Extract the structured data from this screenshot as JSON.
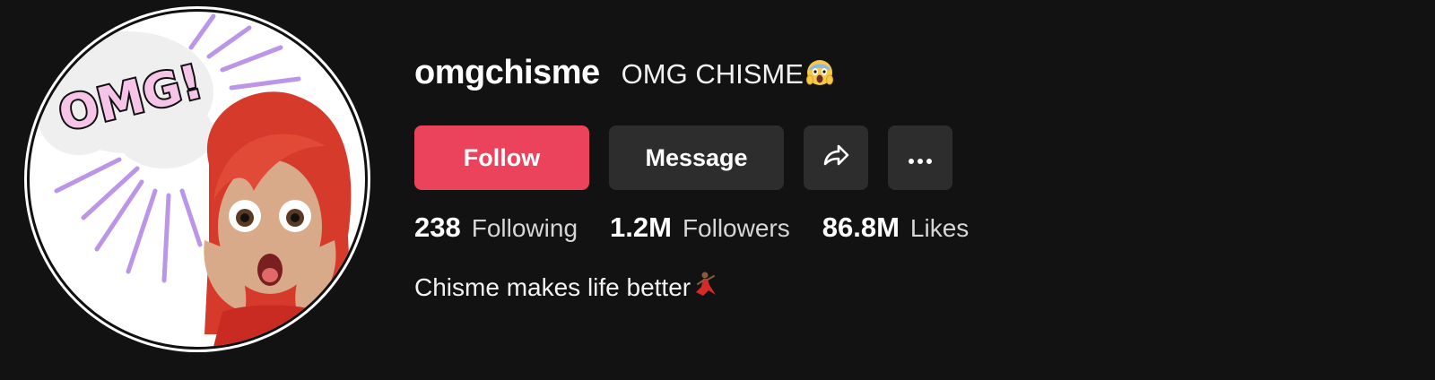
{
  "profile": {
    "username": "omgchisme",
    "nickname": "OMG CHISME",
    "nickname_emoji": "scream-emoji",
    "bio": "Chisme makes life better",
    "bio_emoji": "dancer-emoji",
    "avatar_text": "OMG!"
  },
  "actions": {
    "follow_label": "Follow",
    "message_label": "Message",
    "share_icon": "share-icon",
    "more_icon": "more-icon"
  },
  "stats": [
    {
      "value": "238",
      "label": "Following"
    },
    {
      "value": "1.2M",
      "label": "Followers"
    },
    {
      "value": "86.8M",
      "label": "Likes"
    }
  ],
  "colors": {
    "background": "#121212",
    "follow_button": "#ea435b",
    "secondary_button": "#2d2d2d"
  }
}
